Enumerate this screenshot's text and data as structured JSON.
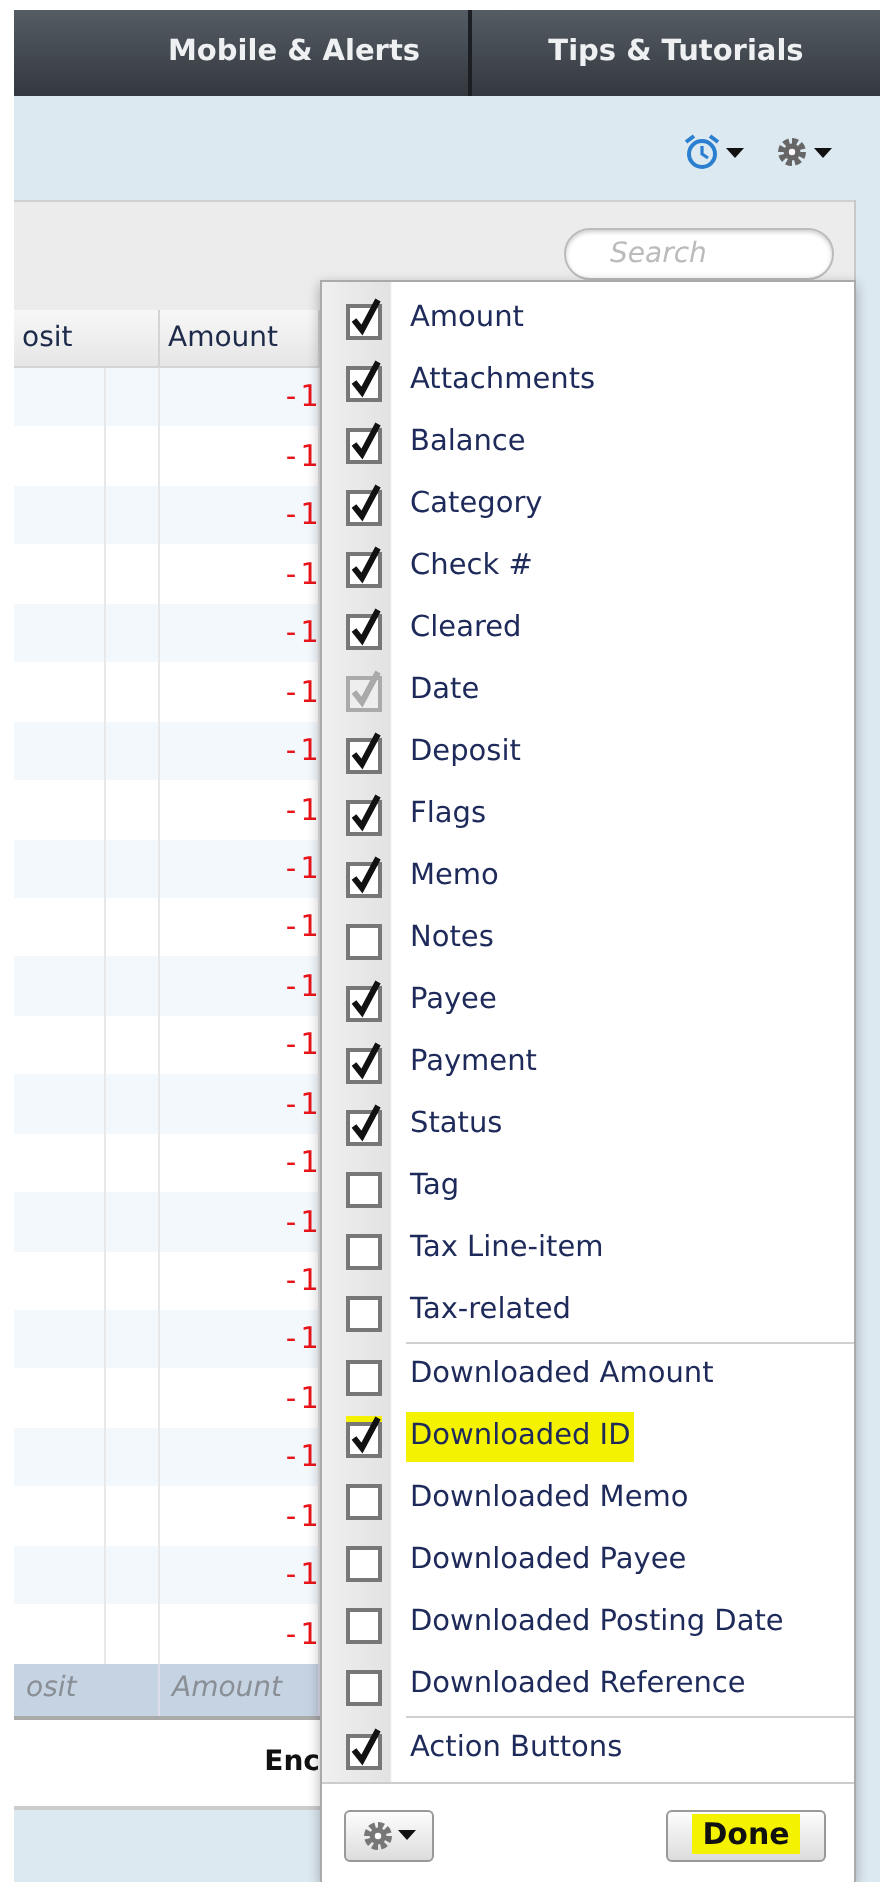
{
  "nav": {
    "tabs": [
      {
        "label": "Mobile & Alerts"
      },
      {
        "label": "Tips & Tutorials"
      }
    ]
  },
  "register": {
    "search": {
      "placeholder": "Search"
    },
    "columns": [
      "osit",
      "Amount"
    ],
    "rows": [
      {
        "amount": "-1"
      },
      {
        "amount": "-1"
      },
      {
        "amount": "-1"
      },
      {
        "amount": "-1"
      },
      {
        "amount": "-1"
      },
      {
        "amount": "-1"
      },
      {
        "amount": "-1"
      },
      {
        "amount": "-1"
      },
      {
        "amount": "-1"
      },
      {
        "amount": "-1"
      },
      {
        "amount": "-1"
      },
      {
        "amount": "-1"
      },
      {
        "amount": "-1"
      },
      {
        "amount": "-1"
      },
      {
        "amount": "-1"
      },
      {
        "amount": "-1"
      },
      {
        "amount": "-1"
      },
      {
        "amount": "-1"
      },
      {
        "amount": "-1"
      },
      {
        "amount": "-1"
      },
      {
        "amount": "-1"
      },
      {
        "amount": "-1"
      }
    ],
    "footer_columns": [
      "osit",
      "Amount"
    ],
    "summary": "Enc"
  },
  "column_menu": {
    "groups": [
      [
        {
          "label": "Amount",
          "checked": true,
          "disabled": false,
          "highlighted": false
        },
        {
          "label": "Attachments",
          "checked": true,
          "disabled": false,
          "highlighted": false
        },
        {
          "label": "Balance",
          "checked": true,
          "disabled": false,
          "highlighted": false
        },
        {
          "label": "Category",
          "checked": true,
          "disabled": false,
          "highlighted": false
        },
        {
          "label": "Check #",
          "checked": true,
          "disabled": false,
          "highlighted": false
        },
        {
          "label": "Cleared",
          "checked": true,
          "disabled": false,
          "highlighted": false
        },
        {
          "label": "Date",
          "checked": true,
          "disabled": true,
          "highlighted": false
        },
        {
          "label": "Deposit",
          "checked": true,
          "disabled": false,
          "highlighted": false
        },
        {
          "label": "Flags",
          "checked": true,
          "disabled": false,
          "highlighted": false
        },
        {
          "label": "Memo",
          "checked": true,
          "disabled": false,
          "highlighted": false
        },
        {
          "label": "Notes",
          "checked": false,
          "disabled": false,
          "highlighted": false
        },
        {
          "label": "Payee",
          "checked": true,
          "disabled": false,
          "highlighted": false
        },
        {
          "label": "Payment",
          "checked": true,
          "disabled": false,
          "highlighted": false
        },
        {
          "label": "Status",
          "checked": true,
          "disabled": false,
          "highlighted": false
        },
        {
          "label": "Tag",
          "checked": false,
          "disabled": false,
          "highlighted": false
        },
        {
          "label": "Tax Line-item",
          "checked": false,
          "disabled": false,
          "highlighted": false
        },
        {
          "label": "Tax-related",
          "checked": false,
          "disabled": false,
          "highlighted": false
        }
      ],
      [
        {
          "label": "Downloaded Amount",
          "checked": false,
          "disabled": false,
          "highlighted": false
        },
        {
          "label": "Downloaded ID",
          "checked": true,
          "disabled": false,
          "highlighted": true
        },
        {
          "label": "Downloaded Memo",
          "checked": false,
          "disabled": false,
          "highlighted": false
        },
        {
          "label": "Downloaded Payee",
          "checked": false,
          "disabled": false,
          "highlighted": false
        },
        {
          "label": "Downloaded Posting Date",
          "checked": false,
          "disabled": false,
          "highlighted": false
        },
        {
          "label": "Downloaded Reference",
          "checked": false,
          "disabled": false,
          "highlighted": false
        }
      ],
      [
        {
          "label": "Action Buttons",
          "checked": true,
          "disabled": false,
          "highlighted": false
        }
      ]
    ],
    "done": {
      "label": "Done",
      "highlighted": true
    }
  }
}
